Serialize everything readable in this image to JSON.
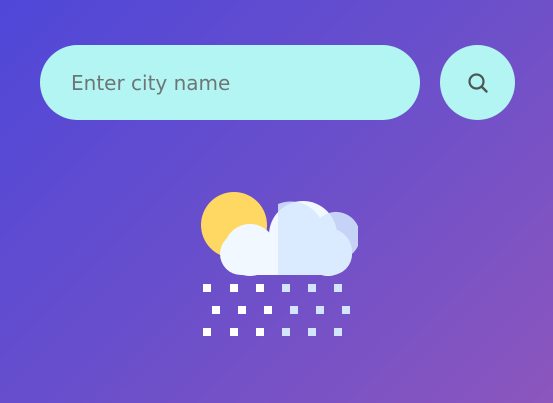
{
  "search": {
    "placeholder": "Enter city name",
    "value": "",
    "button_icon": "search-icon"
  },
  "weather": {
    "icon": "cloudy-snow-icon"
  },
  "colors": {
    "input_bg": "#b3f5f3",
    "background_start": "#4f47d8",
    "background_end": "#8c56bd",
    "sun": "#ffd863",
    "cloud": "#f2f8ff",
    "snow": "#ffffff"
  }
}
